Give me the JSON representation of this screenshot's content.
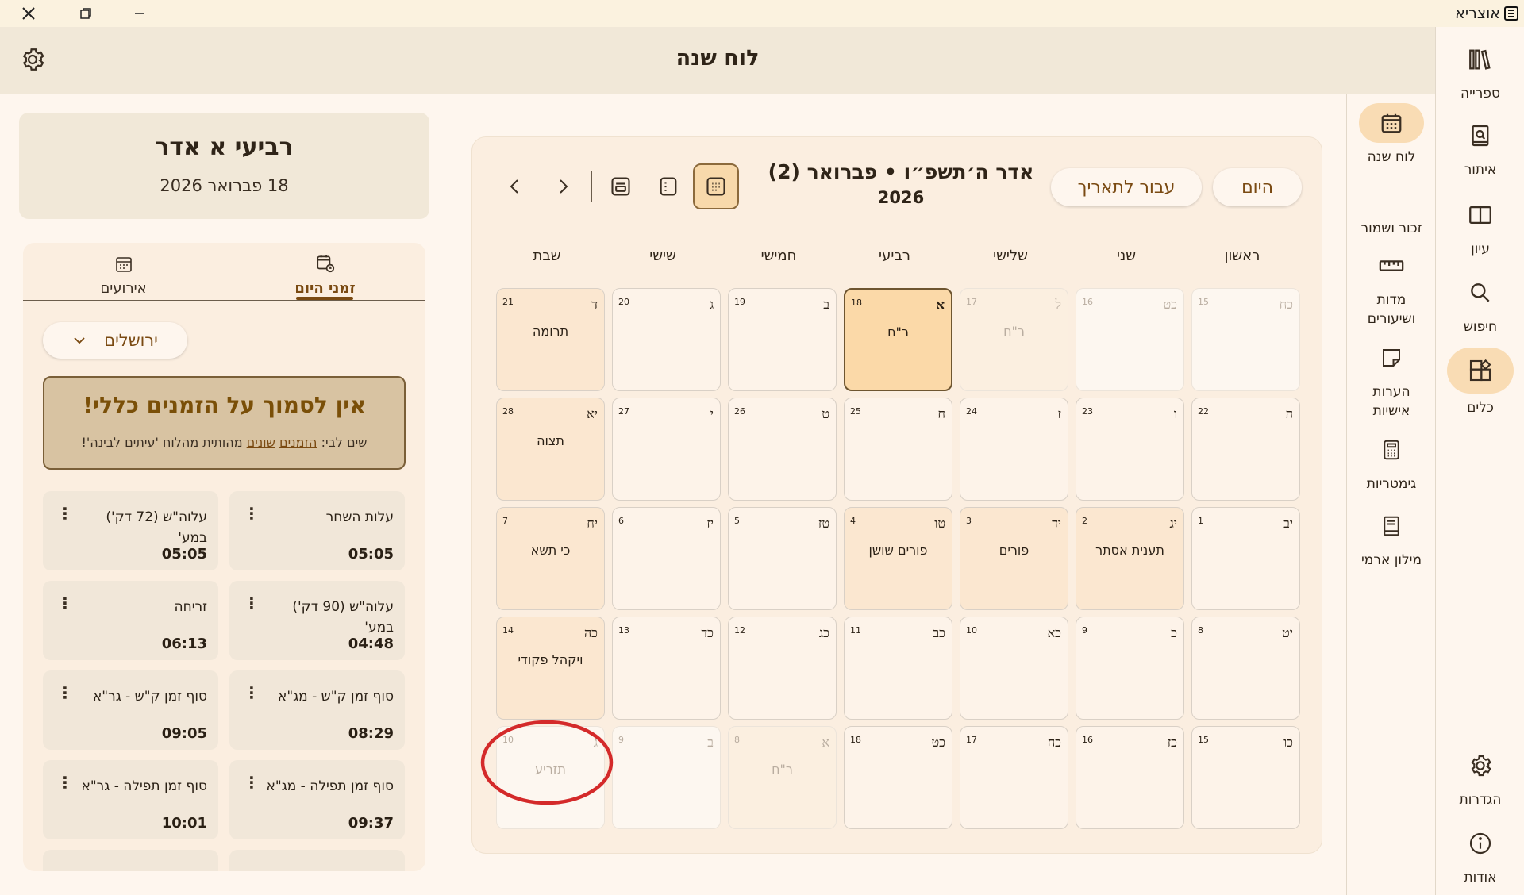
{
  "app": {
    "title": "אוצריא"
  },
  "header": {
    "title": "לוח שנה"
  },
  "rail_outer": [
    {
      "label": "ספרייה",
      "icon": "library-icon"
    },
    {
      "label": "איתור",
      "icon": "find-book-icon"
    },
    {
      "label": "עיון",
      "icon": "book-open-icon"
    },
    {
      "label": "חיפוש",
      "icon": "search-icon"
    },
    {
      "label": "כלים",
      "icon": "tools-icon",
      "active": true
    }
  ],
  "rail_outer_bottom": [
    {
      "label": "הגדרות",
      "icon": "gear-icon"
    },
    {
      "label": "אודות",
      "icon": "info-icon"
    }
  ],
  "rail_inner": [
    {
      "label": "לוח שנה",
      "icon": "calendar-icon",
      "active": true
    },
    {
      "label": "זכור ושמור",
      "icon": ""
    },
    {
      "label": "מדות ושיעורים",
      "icon": "ruler-icon"
    },
    {
      "label": "הערות אישיות",
      "icon": "note-icon"
    },
    {
      "label": "גימטריות",
      "icon": "calculator-icon"
    },
    {
      "label": "מילון ארמי",
      "icon": "dictionary-icon"
    }
  ],
  "calendar": {
    "today_label": "היום",
    "goto_label": "עבור לתאריך",
    "title_line1": "אדר ה׳תשפ״ו • פברואר (2)",
    "title_line2": "2026",
    "weekdays": [
      "ראשון",
      "שני",
      "שלישי",
      "רביעי",
      "חמישי",
      "שישי",
      "שבת"
    ],
    "weeks": [
      [
        {
          "heb": "כח",
          "greg": "15",
          "faded": true
        },
        {
          "heb": "כט",
          "greg": "16",
          "faded": true
        },
        {
          "heb": "ל",
          "greg": "17",
          "event": "ר\"ח",
          "faded": true,
          "hol": true
        },
        {
          "heb": "א",
          "greg": "18",
          "event": "ר\"ח",
          "today": true
        },
        {
          "heb": "ב",
          "greg": "19"
        },
        {
          "heb": "ג",
          "greg": "20"
        },
        {
          "heb": "ד",
          "greg": "21",
          "event": "תרומה",
          "hol": true
        }
      ],
      [
        {
          "heb": "ה",
          "greg": "22"
        },
        {
          "heb": "ו",
          "greg": "23"
        },
        {
          "heb": "ז",
          "greg": "24"
        },
        {
          "heb": "ח",
          "greg": "25"
        },
        {
          "heb": "ט",
          "greg": "26"
        },
        {
          "heb": "י",
          "greg": "27"
        },
        {
          "heb": "יא",
          "greg": "28",
          "event": "תצוה",
          "hol": true
        }
      ],
      [
        {
          "heb": "יב",
          "greg": "1"
        },
        {
          "heb": "יג",
          "greg": "2",
          "event": "תענית אסתר",
          "hol": true
        },
        {
          "heb": "יד",
          "greg": "3",
          "event": "פורים",
          "hol": true
        },
        {
          "heb": "טו",
          "greg": "4",
          "event": "פורים שושן",
          "hol": true
        },
        {
          "heb": "טז",
          "greg": "5"
        },
        {
          "heb": "יז",
          "greg": "6"
        },
        {
          "heb": "יח",
          "greg": "7",
          "event": "כי תשא",
          "hol": true
        }
      ],
      [
        {
          "heb": "יט",
          "greg": "8"
        },
        {
          "heb": "כ",
          "greg": "9"
        },
        {
          "heb": "כא",
          "greg": "10"
        },
        {
          "heb": "כב",
          "greg": "11"
        },
        {
          "heb": "כג",
          "greg": "12"
        },
        {
          "heb": "כד",
          "greg": "13"
        },
        {
          "heb": "כה",
          "greg": "14",
          "event": "ויקהל פקודי",
          "hol": true
        }
      ],
      [
        {
          "heb": "כו",
          "greg": "15"
        },
        {
          "heb": "כז",
          "greg": "16"
        },
        {
          "heb": "כח",
          "greg": "17"
        },
        {
          "heb": "כט",
          "greg": "18"
        },
        {
          "heb": "א",
          "greg": "8",
          "event": "ר\"ח",
          "faded": true,
          "hol": true
        },
        {
          "heb": "ב",
          "greg": "9",
          "faded": true
        },
        {
          "heb": "ג",
          "greg": "10",
          "event": "תזריע",
          "faded": true
        }
      ]
    ],
    "annotation_color": "#d42a2a"
  },
  "left": {
    "date_title": "רביעי א אדר",
    "date_sub": "18 פברואר 2026",
    "tabs": [
      {
        "label": "זמני היום",
        "icon": "calendar-clock-icon",
        "active": true
      },
      {
        "label": "אירועים",
        "icon": "calendar-icon"
      }
    ],
    "city": "ירושלים",
    "warning": {
      "title": "אין לסמוך על הזמנים כללי!",
      "text_pre": "שים לבי: ",
      "link1": "הזמנים",
      "text_mid": " ",
      "link2": "שונים",
      "text_post": " מהותית מהלוח 'עיתים לבינה'!"
    },
    "zmanim": [
      {
        "name": "עלות השחר",
        "time": "05:05"
      },
      {
        "name": "עלוה\"ש (72 דק') במע'",
        "time": "05:05"
      },
      {
        "name": "עלוה\"ש (90 דק') במע'",
        "time": "04:48"
      },
      {
        "name": "זריחה",
        "time": "06:13"
      },
      {
        "name": "סוף זמן ק\"ש - מג\"א",
        "time": "08:29"
      },
      {
        "name": "סוף זמן ק\"ש - גר\"א",
        "time": "09:05"
      },
      {
        "name": "סוף זמן תפילה - מג\"א",
        "time": "09:37"
      },
      {
        "name": "סוף זמן תפילה - גר\"א",
        "time": "10:01"
      }
    ]
  },
  "colors": {
    "accent": "#7a4a12",
    "today": "#fbd9a8",
    "holiday": "#fbe7d0",
    "warning_bg": "#d8c3a2"
  }
}
